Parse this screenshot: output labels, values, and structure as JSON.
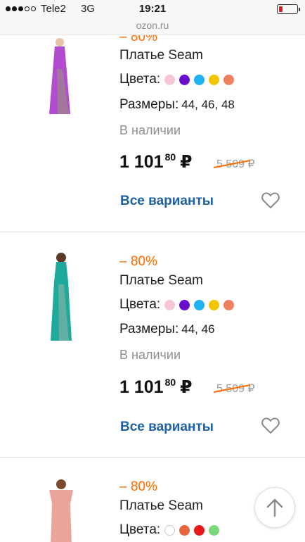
{
  "status_bar": {
    "carrier": "Tele2",
    "network": "3G",
    "time": "19:21",
    "battery_level": 0.2,
    "battery_color": "#e0201b",
    "url": "ozon.ru"
  },
  "products": [
    {
      "discount": "– 80%",
      "title": "Платье Seam",
      "colors_label": "Цвета:",
      "colors": [
        "#f6c6d6",
        "#6a0dce",
        "#1fb1ef",
        "#f5c400",
        "#f08160"
      ],
      "sizes_label": "Размеры:",
      "sizes": "44, 46, 48",
      "availability": "В наличии",
      "price_main": "1 101",
      "price_cents": "80",
      "currency": "₽",
      "old_price": "5 509",
      "old_currency": "₽",
      "all_variants": "Все варианты",
      "dress_color": "#b24bd0"
    },
    {
      "discount": "– 80%",
      "title": "Платье Seam",
      "colors_label": "Цвета:",
      "colors": [
        "#f6c6d6",
        "#6a0dce",
        "#1fb1ef",
        "#f5c400",
        "#f08160"
      ],
      "sizes_label": "Размеры:",
      "sizes": "44, 46",
      "availability": "В наличии",
      "price_main": "1 101",
      "price_cents": "80",
      "currency": "₽",
      "old_price": "5 509",
      "old_currency": "₽",
      "all_variants": "Все варианты",
      "dress_color": "#1fa99a"
    },
    {
      "discount": "– 80%",
      "title": "Платье Seam",
      "colors_label": "Цвета:",
      "colors": [
        "#ffffff",
        "#e8663e",
        "#e81818",
        "#7bd87b"
      ],
      "dress_color": "#e9a59a"
    }
  ],
  "accent_colors": {
    "discount": "#ff6b00",
    "link": "#1f5fa3"
  }
}
